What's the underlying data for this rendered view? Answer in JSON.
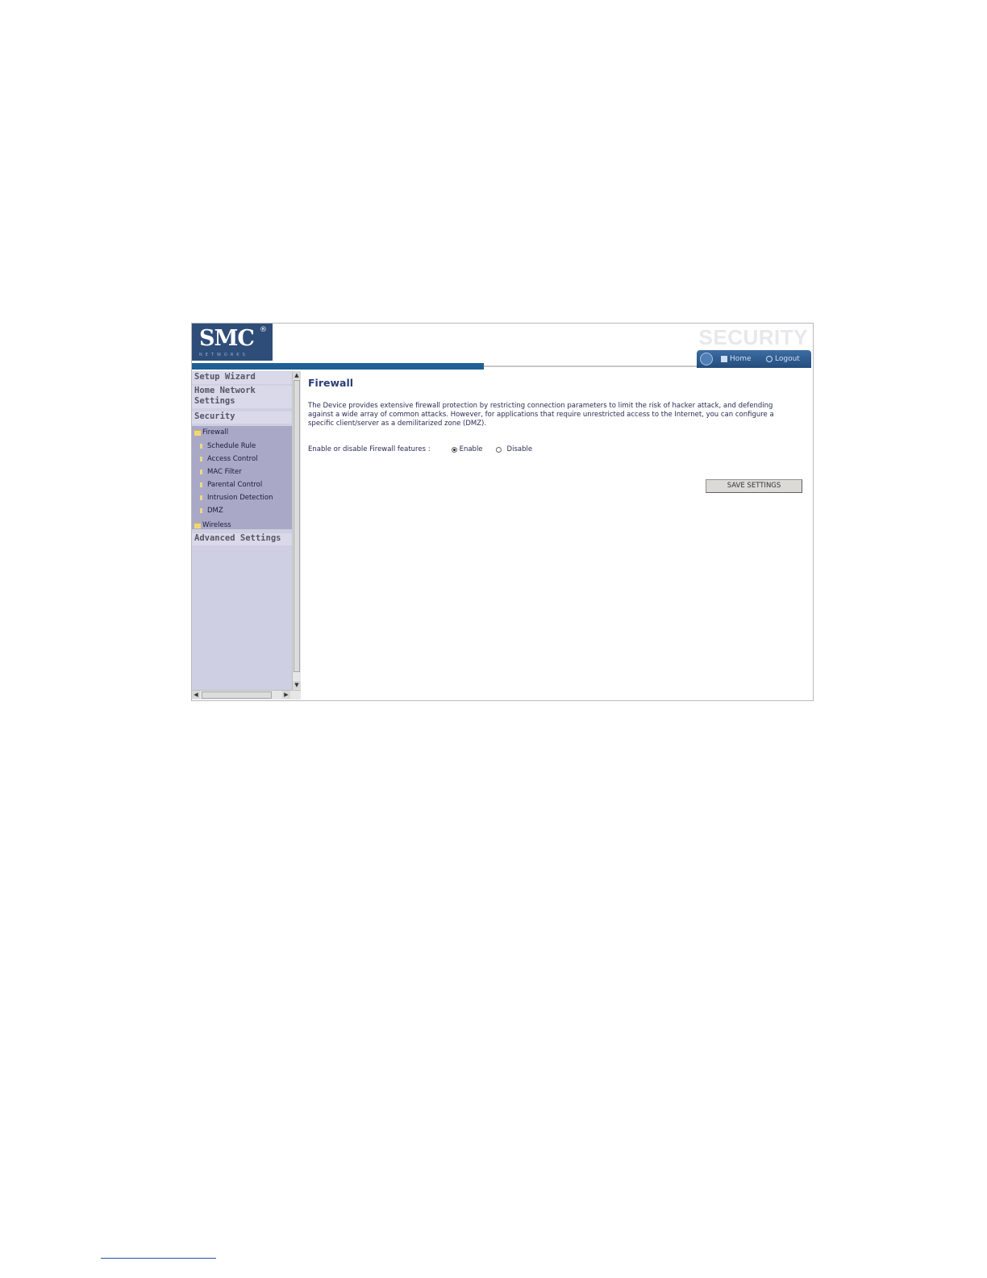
{
  "header": {
    "logo_text": "SMC",
    "logo_mark": "®",
    "logo_tagline": "NETWORKS",
    "section_title": "SECURITY",
    "nav_home": "Home",
    "nav_logout": "Logout"
  },
  "sidebar": {
    "setup_wizard": "Setup Wizard",
    "home_network": "Home Network Settings",
    "security": "Security",
    "firewall": "Firewall",
    "firewall_items": [
      "Schedule Rule",
      "Access Control",
      "MAC Filter",
      "Parental Control",
      "Intrusion Detection",
      "DMZ"
    ],
    "wireless": "Wireless",
    "advanced": "Advanced Settings"
  },
  "main": {
    "title": "Firewall",
    "description": "The Device provides extensive firewall protection by restricting connection parameters to limit the risk of hacker attack, and defending against a wide array of common attacks. However, for applications that require unrestricted access to the Internet, you can configure a specific client/server as a demilitarized zone (DMZ).",
    "field_label": "Enable or disable Firewall features :",
    "option_enable": "Enable",
    "option_disable": "Disable",
    "selected_option": "Enable",
    "save_button": "SAVE SETTINGS"
  },
  "icons": {
    "globe": "globe-icon",
    "home": "home-icon",
    "logout": "logout-icon",
    "folder": "folder-icon",
    "leaf": "leaf-icon"
  },
  "colors": {
    "brand_blue": "#2f4d79",
    "bar_blue": "#1f5f94",
    "sidebar_bg": "#cfcfe3",
    "title_text": "#2b3d76"
  }
}
